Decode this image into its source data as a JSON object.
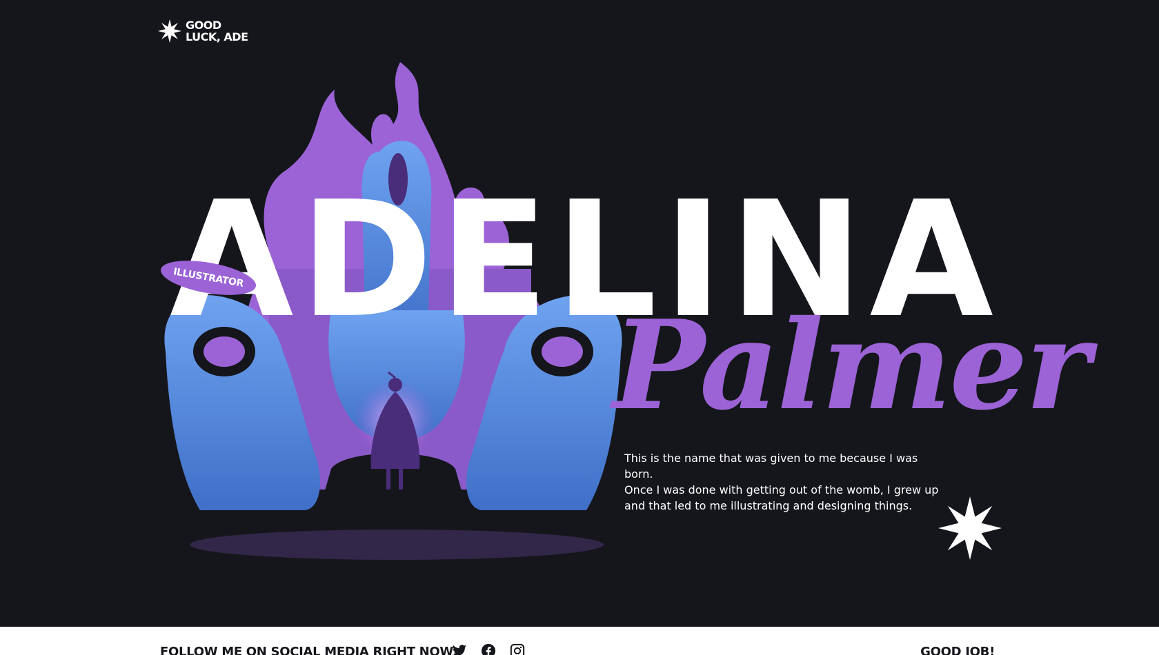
{
  "header": {
    "logo_line1": "GOOD",
    "logo_line2": "LUCK, ADE",
    "logo_icon": "sparkle-star-icon"
  },
  "hero": {
    "first_name_letters": [
      "A",
      "D",
      "E",
      "L",
      "I",
      "N",
      "A"
    ],
    "last_name": "Palmer",
    "badge": "ILLUSTRATOR",
    "bio_lines": [
      "This is the name that was given to me because I was born.",
      "Once I was done with getting out of the womb, I grew up",
      "and that led to me illustrating and designing things."
    ]
  },
  "footer": {
    "social_label": "FOLLOW ME ON SOCIAL MEDIA RIGHT NOW:",
    "social_icons": [
      "twitter-icon",
      "facebook-icon",
      "instagram-icon"
    ],
    "right_text": "GOOD JOB!"
  },
  "colors": {
    "background": "#15161b",
    "accent_purple": "#9b63d6",
    "hand_blue": "#5a8fe0",
    "text_white": "#ffffff",
    "footer_bg": "#ffffff"
  }
}
